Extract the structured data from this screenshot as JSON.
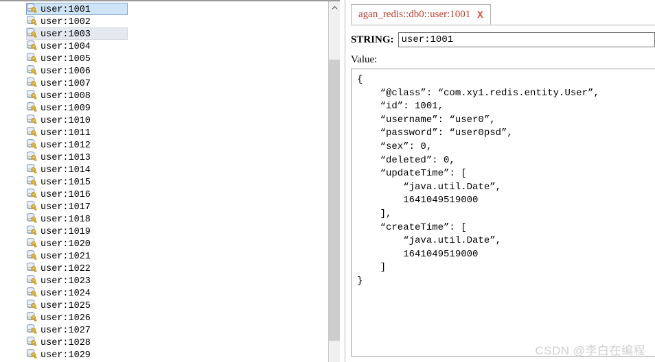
{
  "key_list": {
    "icon_name": "redis-key-icon",
    "items": [
      {
        "label": "user:1001",
        "selected": "primary"
      },
      {
        "label": "user:1002",
        "selected": "none"
      },
      {
        "label": "user:1003",
        "selected": "secondary"
      },
      {
        "label": "user:1004",
        "selected": "none"
      },
      {
        "label": "user:1005",
        "selected": "none"
      },
      {
        "label": "user:1006",
        "selected": "none"
      },
      {
        "label": "user:1007",
        "selected": "none"
      },
      {
        "label": "user:1008",
        "selected": "none"
      },
      {
        "label": "user:1009",
        "selected": "none"
      },
      {
        "label": "user:1010",
        "selected": "none"
      },
      {
        "label": "user:1011",
        "selected": "none"
      },
      {
        "label": "user:1012",
        "selected": "none"
      },
      {
        "label": "user:1013",
        "selected": "none"
      },
      {
        "label": "user:1014",
        "selected": "none"
      },
      {
        "label": "user:1015",
        "selected": "none"
      },
      {
        "label": "user:1016",
        "selected": "none"
      },
      {
        "label": "user:1017",
        "selected": "none"
      },
      {
        "label": "user:1018",
        "selected": "none"
      },
      {
        "label": "user:1019",
        "selected": "none"
      },
      {
        "label": "user:1020",
        "selected": "none"
      },
      {
        "label": "user:1021",
        "selected": "none"
      },
      {
        "label": "user:1022",
        "selected": "none"
      },
      {
        "label": "user:1023",
        "selected": "none"
      },
      {
        "label": "user:1024",
        "selected": "none"
      },
      {
        "label": "user:1025",
        "selected": "none"
      },
      {
        "label": "user:1026",
        "selected": "none"
      },
      {
        "label": "user:1027",
        "selected": "none"
      },
      {
        "label": "user:1028",
        "selected": "none"
      },
      {
        "label": "user:1029",
        "selected": "none"
      }
    ]
  },
  "scrollbar": {
    "up_arrow_icon": "chevron-up-icon"
  },
  "detail": {
    "tab": {
      "label": "agan_redis::db0::user:1001",
      "label_color": "#c0392b",
      "close_icon": "close-x-icon",
      "close_icon_color": "#e8543f"
    },
    "type_label": "STRING:",
    "key_value": "user:1001",
    "value_label": "Value:",
    "value_json": "{\n    “@class”: “com.xy1.redis.entity.User”,\n    “id”: 1001,\n    “username”: “user0”,\n    “password”: “user0psd”,\n    “sex”: 0,\n    “deleted”: 0,\n    “updateTime”: [\n        “java.util.Date”,\n        1641049519000\n    ],\n    “createTime”: [\n        “java.util.Date”,\n        1641049519000\n    ]\n}"
  },
  "watermark": {
    "text": "CSDN @李白在编程",
    "color": "#d0d0d0"
  }
}
